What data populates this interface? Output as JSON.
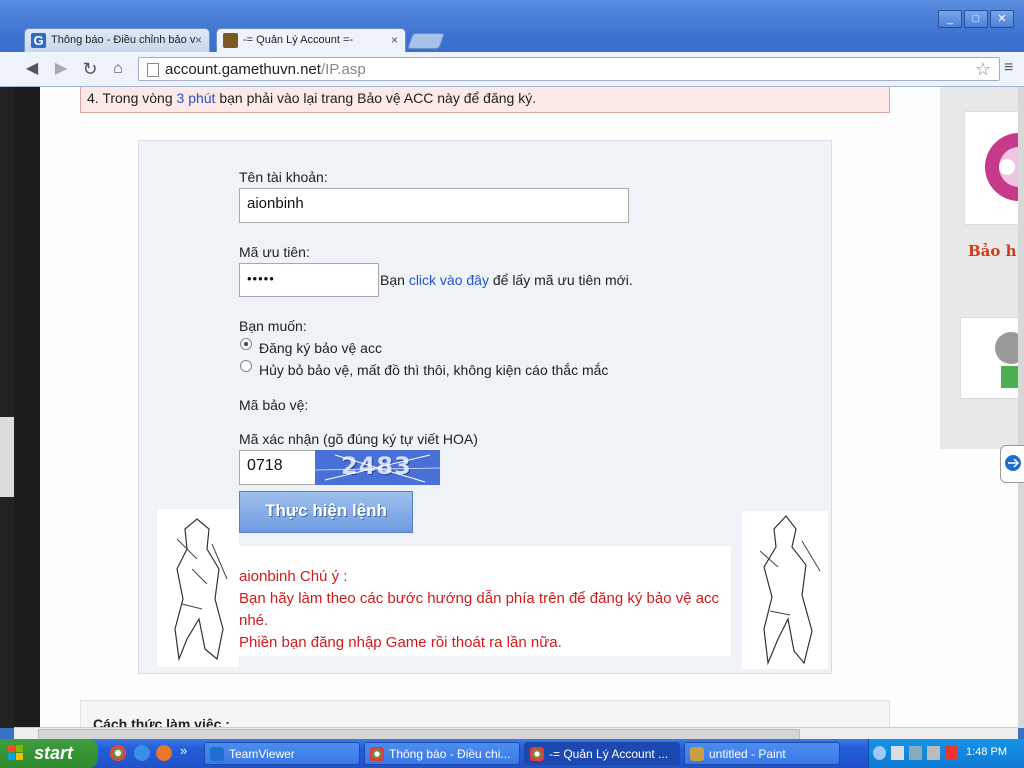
{
  "browser": {
    "tabs": [
      {
        "title": "Thông báo - Điều chỉnh bảo v",
        "close": "×"
      },
      {
        "title": "-= Quản Lý Account =-",
        "close": "×"
      }
    ],
    "url_host": "account.gamethuvn.net",
    "url_path": "/IP.asp",
    "window_controls": {
      "minimize": "_",
      "maximize": "□",
      "close": "✕"
    }
  },
  "page": {
    "notice": {
      "pre": "4. Trong vòng ",
      "highlight": "3 phút",
      "post": " bạn phải vào lại trang Bảo vệ ACC này để đăng ký."
    },
    "form": {
      "account_label": "Tên tài khoản:",
      "account_value": "aionbinh",
      "priority_label": "Mã ưu tiên:",
      "priority_value": "•••••",
      "priority_hint_pre": "Bạn ",
      "priority_hint_link": "click vào đây",
      "priority_hint_post": " để lấy mã ưu tiên mới.",
      "want_label": "Bạn muốn:",
      "options": [
        {
          "label": "Đăng ký bảo vệ acc",
          "selected": true
        },
        {
          "label": "Hủy bỏ bảo vệ, mất đồ thì thôi, không kiện cáo thắc mắc",
          "selected": false
        }
      ],
      "protect_label": "Mã bảo vệ:",
      "confirm_label": "Mã xác nhận (gõ đúng ký tự viết HOA)",
      "confirm_value": "0718",
      "captcha_text": "2483",
      "submit_label": "Thực hiện lệnh"
    },
    "message": {
      "line1": "aionbinh Chú ý :",
      "line2": "Bạn hãy làm theo các bước hướng dẫn phía trên để đăng ký bảo vệ acc",
      "line3": "nhé.",
      "line4": "Phiền bạn đăng nhập Game rồi thoát ra lần nữa."
    },
    "sidebar_text": "Bảo h",
    "bottom_heading": "Cách thức làm việc :"
  },
  "taskbar": {
    "start_label": "start",
    "items": [
      {
        "label": "TeamViewer",
        "active": false
      },
      {
        "label": "Thông báo - Điều chi...",
        "active": false
      },
      {
        "label": "-= Quản Lý Account ...",
        "active": true
      },
      {
        "label": "untitled - Paint",
        "active": false
      }
    ],
    "clock": "1:48 PM",
    "chevron": "»"
  }
}
